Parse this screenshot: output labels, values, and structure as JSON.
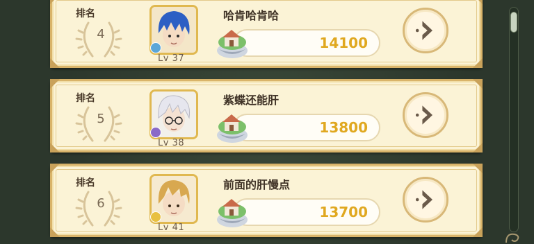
{
  "leaderboard": {
    "rank_label": "排名",
    "entries": [
      {
        "rank": "4",
        "name": "哈肯哈肯哈",
        "level": "Lv 37",
        "score": "14100",
        "hair_color": "#2d5fc4",
        "badge_color": "#5aa6d8"
      },
      {
        "rank": "5",
        "name": "紫蝶还能肝",
        "level": "Lv 38",
        "score": "13800",
        "hair_color": "#e8e8ee",
        "badge_color": "#8a6ac8"
      },
      {
        "rank": "6",
        "name": "前面的肝慢点",
        "level": "Lv 41",
        "score": "13700",
        "hair_color": "#d8a850",
        "badge_color": "#e8c040"
      }
    ]
  },
  "colors": {
    "card_bg": "#fbf3d6",
    "card_border": "#d9b46a",
    "score_text": "#e0a820",
    "background": "#2f3b2f"
  },
  "icons": {
    "laurel": "laurel-wreath-icon",
    "house": "floating-island-house-icon",
    "go": "arrow-right-icon"
  }
}
